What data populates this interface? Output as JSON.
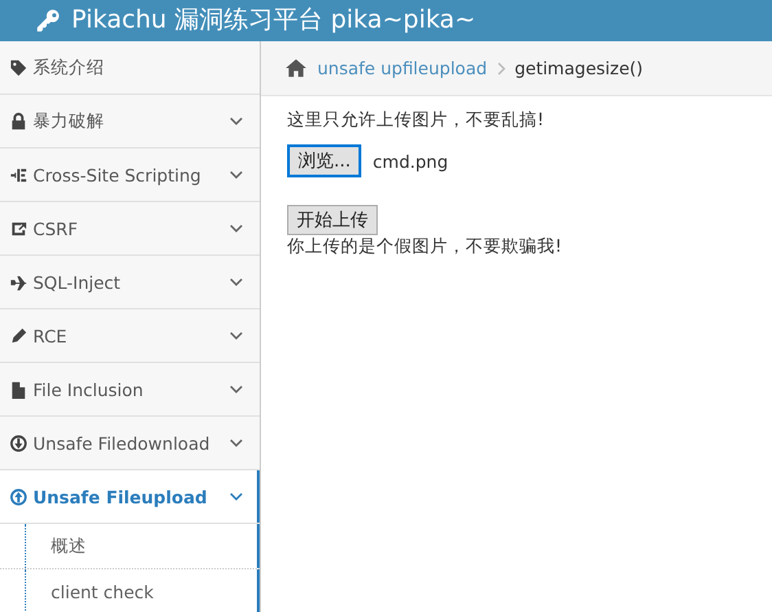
{
  "header": {
    "title": "Pikachu 漏洞练习平台 pika~pika~"
  },
  "sidebar": {
    "items": [
      {
        "label": "系统介绍",
        "selected": false,
        "has_caret": false
      },
      {
        "label": "暴力破解",
        "selected": false,
        "has_caret": true
      },
      {
        "label": "Cross-Site Scripting",
        "selected": false,
        "has_caret": true
      },
      {
        "label": "CSRF",
        "selected": false,
        "has_caret": true
      },
      {
        "label": "SQL-Inject",
        "selected": false,
        "has_caret": true
      },
      {
        "label": "RCE",
        "selected": false,
        "has_caret": true
      },
      {
        "label": "File Inclusion",
        "selected": false,
        "has_caret": true
      },
      {
        "label": "Unsafe Filedownload",
        "selected": false,
        "has_caret": true
      },
      {
        "label": "Unsafe Fileupload",
        "selected": true,
        "has_caret": true,
        "children": [
          {
            "label": "概述"
          },
          {
            "label": "client check"
          }
        ]
      }
    ]
  },
  "breadcrumb": {
    "link": "unsafe upfileupload",
    "current": "getimagesize()"
  },
  "content": {
    "instruction": "这里只允许上传图片，不要乱搞!",
    "browse_button": "浏览...",
    "file_name": "cmd.png",
    "upload_button": "开始上传",
    "message": "你上传的是个假图片，不要欺骗我!"
  }
}
